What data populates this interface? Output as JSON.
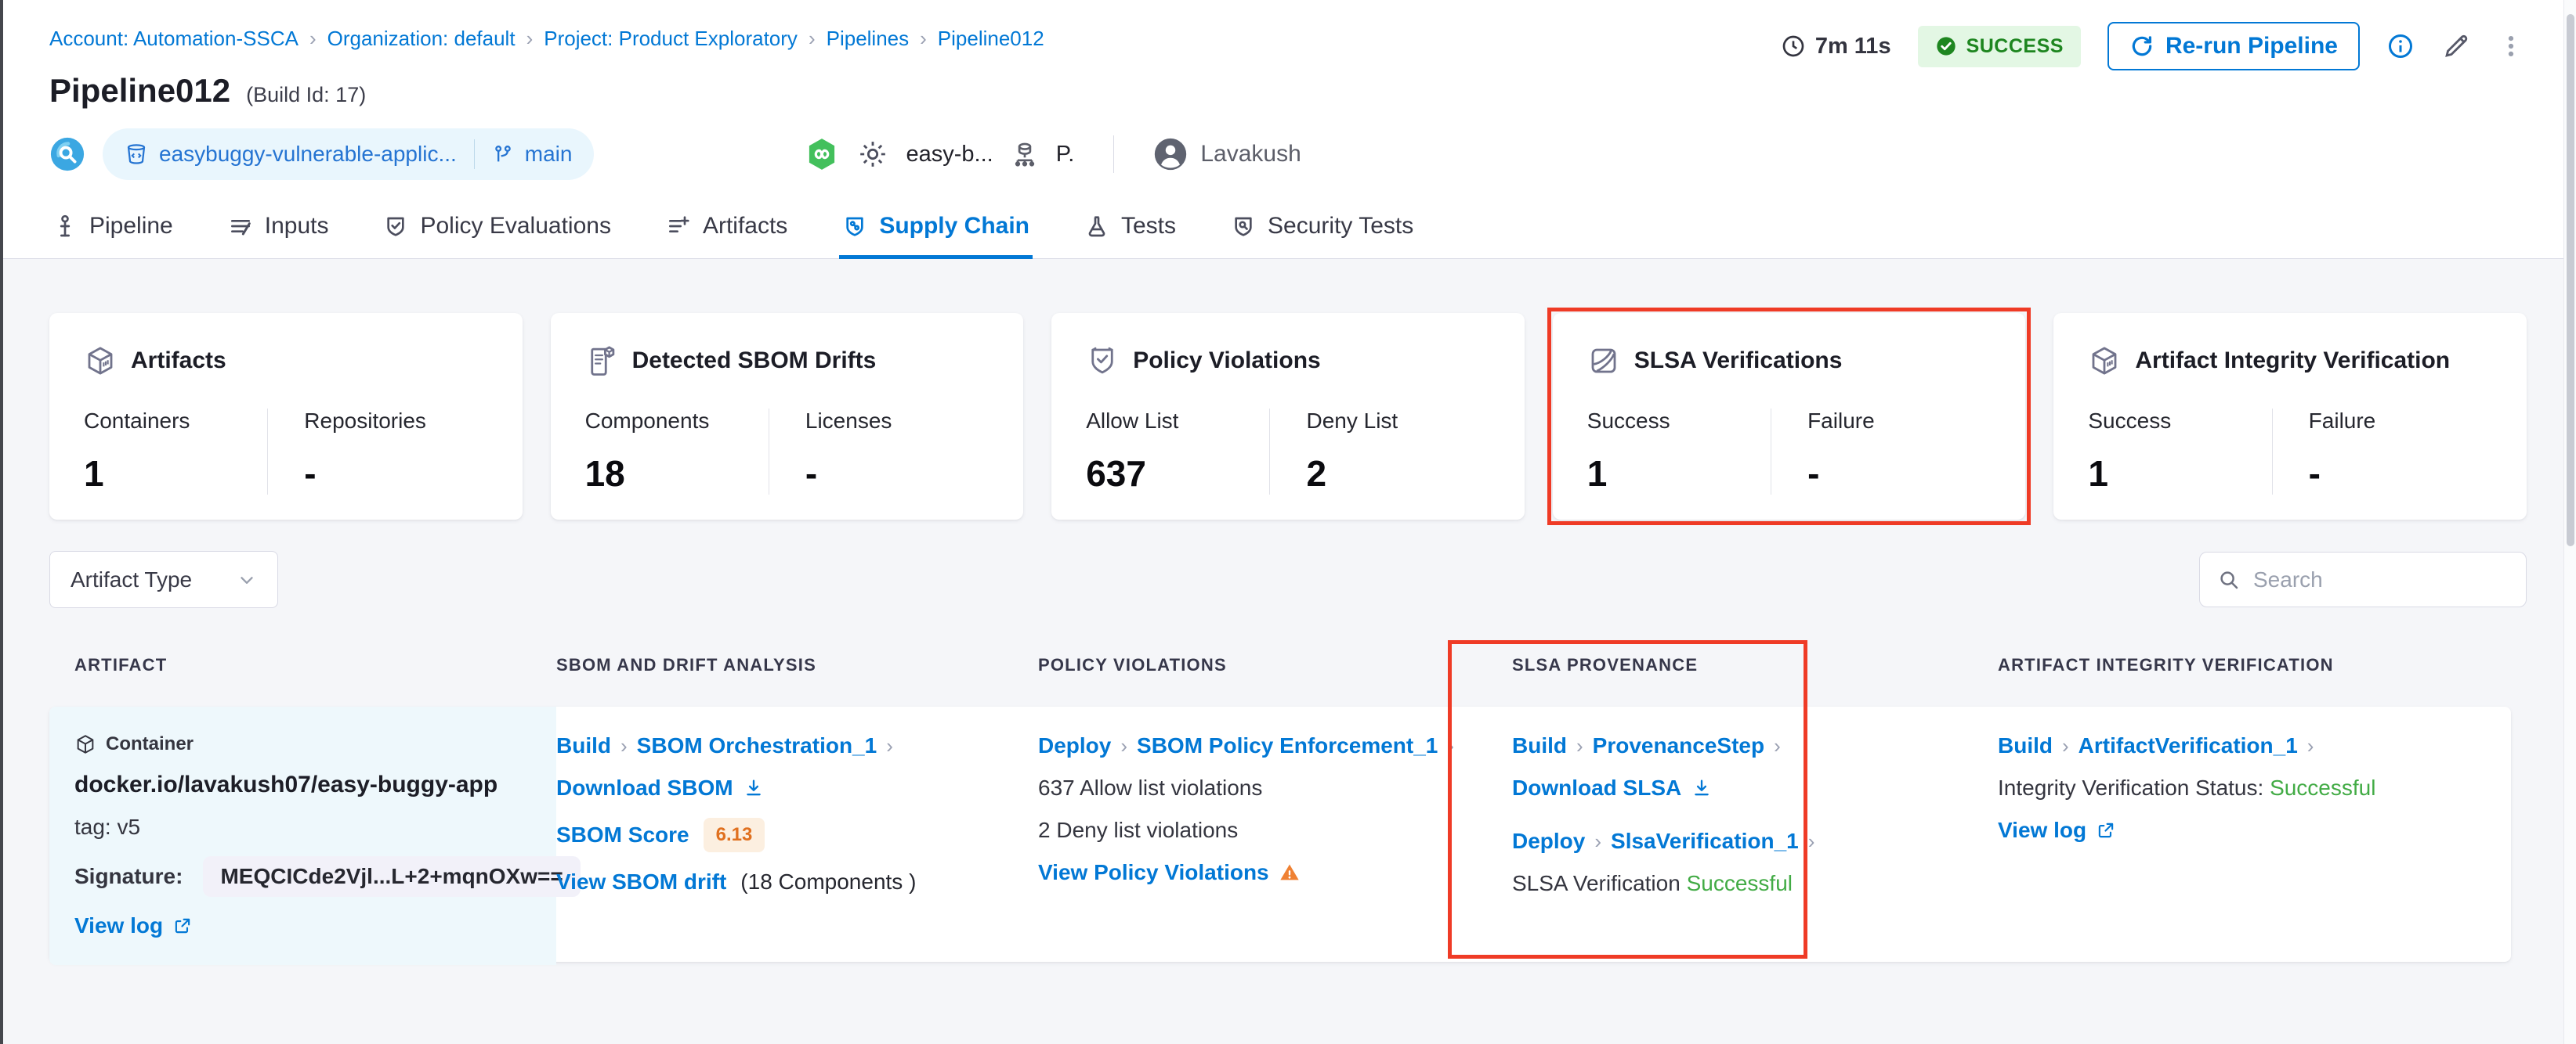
{
  "breadcrumb": {
    "items": [
      "Account: Automation-SSCA",
      "Organization: default",
      "Project: Product Exploratory",
      "Pipelines",
      "Pipeline012"
    ]
  },
  "header": {
    "title": "Pipeline012",
    "build_id": "(Build Id: 17)",
    "duration": "7m 11s",
    "status": "SUCCESS",
    "rerun_label": "Re-run Pipeline",
    "repo_name": "easybuggy-vulnerable-applic...",
    "branch": "main",
    "trigger_name": "easy-b...",
    "trigger_suffix": "P.",
    "user_name": "Lavakush"
  },
  "tabs": [
    {
      "label": "Pipeline",
      "active": false
    },
    {
      "label": "Inputs",
      "active": false
    },
    {
      "label": "Policy Evaluations",
      "active": false
    },
    {
      "label": "Artifacts",
      "active": false
    },
    {
      "label": "Supply Chain",
      "active": true
    },
    {
      "label": "Tests",
      "active": false
    },
    {
      "label": "Security Tests",
      "active": false
    }
  ],
  "cards": [
    {
      "title": "Artifacts",
      "icon": "cube-icon",
      "metrics": [
        {
          "label": "Containers",
          "value": "1"
        },
        {
          "label": "Repositories",
          "value": "-"
        }
      ]
    },
    {
      "title": "Detected SBOM Drifts",
      "icon": "sbom-document-icon",
      "metrics": [
        {
          "label": "Components",
          "value": "18"
        },
        {
          "label": "Licenses",
          "value": "-"
        }
      ]
    },
    {
      "title": "Policy Violations",
      "icon": "shield-check-icon",
      "metrics": [
        {
          "label": "Allow List",
          "value": "637"
        },
        {
          "label": "Deny List",
          "value": "2"
        }
      ]
    },
    {
      "title": "SLSA Verifications",
      "icon": "slsa-icon",
      "highlighted": true,
      "metrics": [
        {
          "label": "Success",
          "value": "1"
        },
        {
          "label": "Failure",
          "value": "-"
        }
      ]
    },
    {
      "title": "Artifact Integrity Verification",
      "icon": "cube-icon",
      "metrics": [
        {
          "label": "Success",
          "value": "1"
        },
        {
          "label": "Failure",
          "value": "-"
        }
      ]
    }
  ],
  "filters": {
    "artifact_type_label": "Artifact Type",
    "search_placeholder": "Search"
  },
  "table": {
    "columns": [
      "ARTIFACT",
      "SBOM AND DRIFT ANALYSIS",
      "POLICY VIOLATIONS",
      "SLSA PROVENANCE",
      "ARTIFACT INTEGRITY VERIFICATION"
    ],
    "row": {
      "artifact": {
        "type_label": "Container",
        "name": "docker.io/lavakush07/easy-buggy-app",
        "tag": "tag: v5",
        "signature_label": "Signature:",
        "signature": "MEQCICde2Vjl...L+2+mqnOXw==",
        "view_log": "View log"
      },
      "sbom": {
        "stage": "Build",
        "step": "SBOM Orchestration_1",
        "download": "Download SBOM",
        "score_label": "SBOM Score",
        "score": "6.13",
        "drift_link": "View SBOM drift",
        "drift_suffix": "(18 Components )"
      },
      "policy": {
        "stage": "Deploy",
        "step": "SBOM Policy Enforcement_1",
        "allow": "637 Allow list violations",
        "deny": "2 Deny list violations",
        "view": "View Policy Violations"
      },
      "slsa": {
        "stage1": "Build",
        "step1": "ProvenanceStep",
        "download": "Download SLSA",
        "stage2": "Deploy",
        "step2": "SlsaVerification_1",
        "status_label": "SLSA Verification",
        "status_value": "Successful"
      },
      "integrity": {
        "stage": "Build",
        "step": "ArtifactVerification_1",
        "status_label": "Integrity Verification Status:",
        "status_value": "Successful",
        "view_log": "View log"
      }
    }
  },
  "colors": {
    "accent_blue": "#0278d5",
    "success_green": "#42ab45",
    "badge_green_bg": "#e3f7e4",
    "badge_green_text": "#1e8620",
    "highlight_red": "#ef3b26",
    "warning_orange": "#ef8133",
    "score_orange": "#e0701f"
  }
}
